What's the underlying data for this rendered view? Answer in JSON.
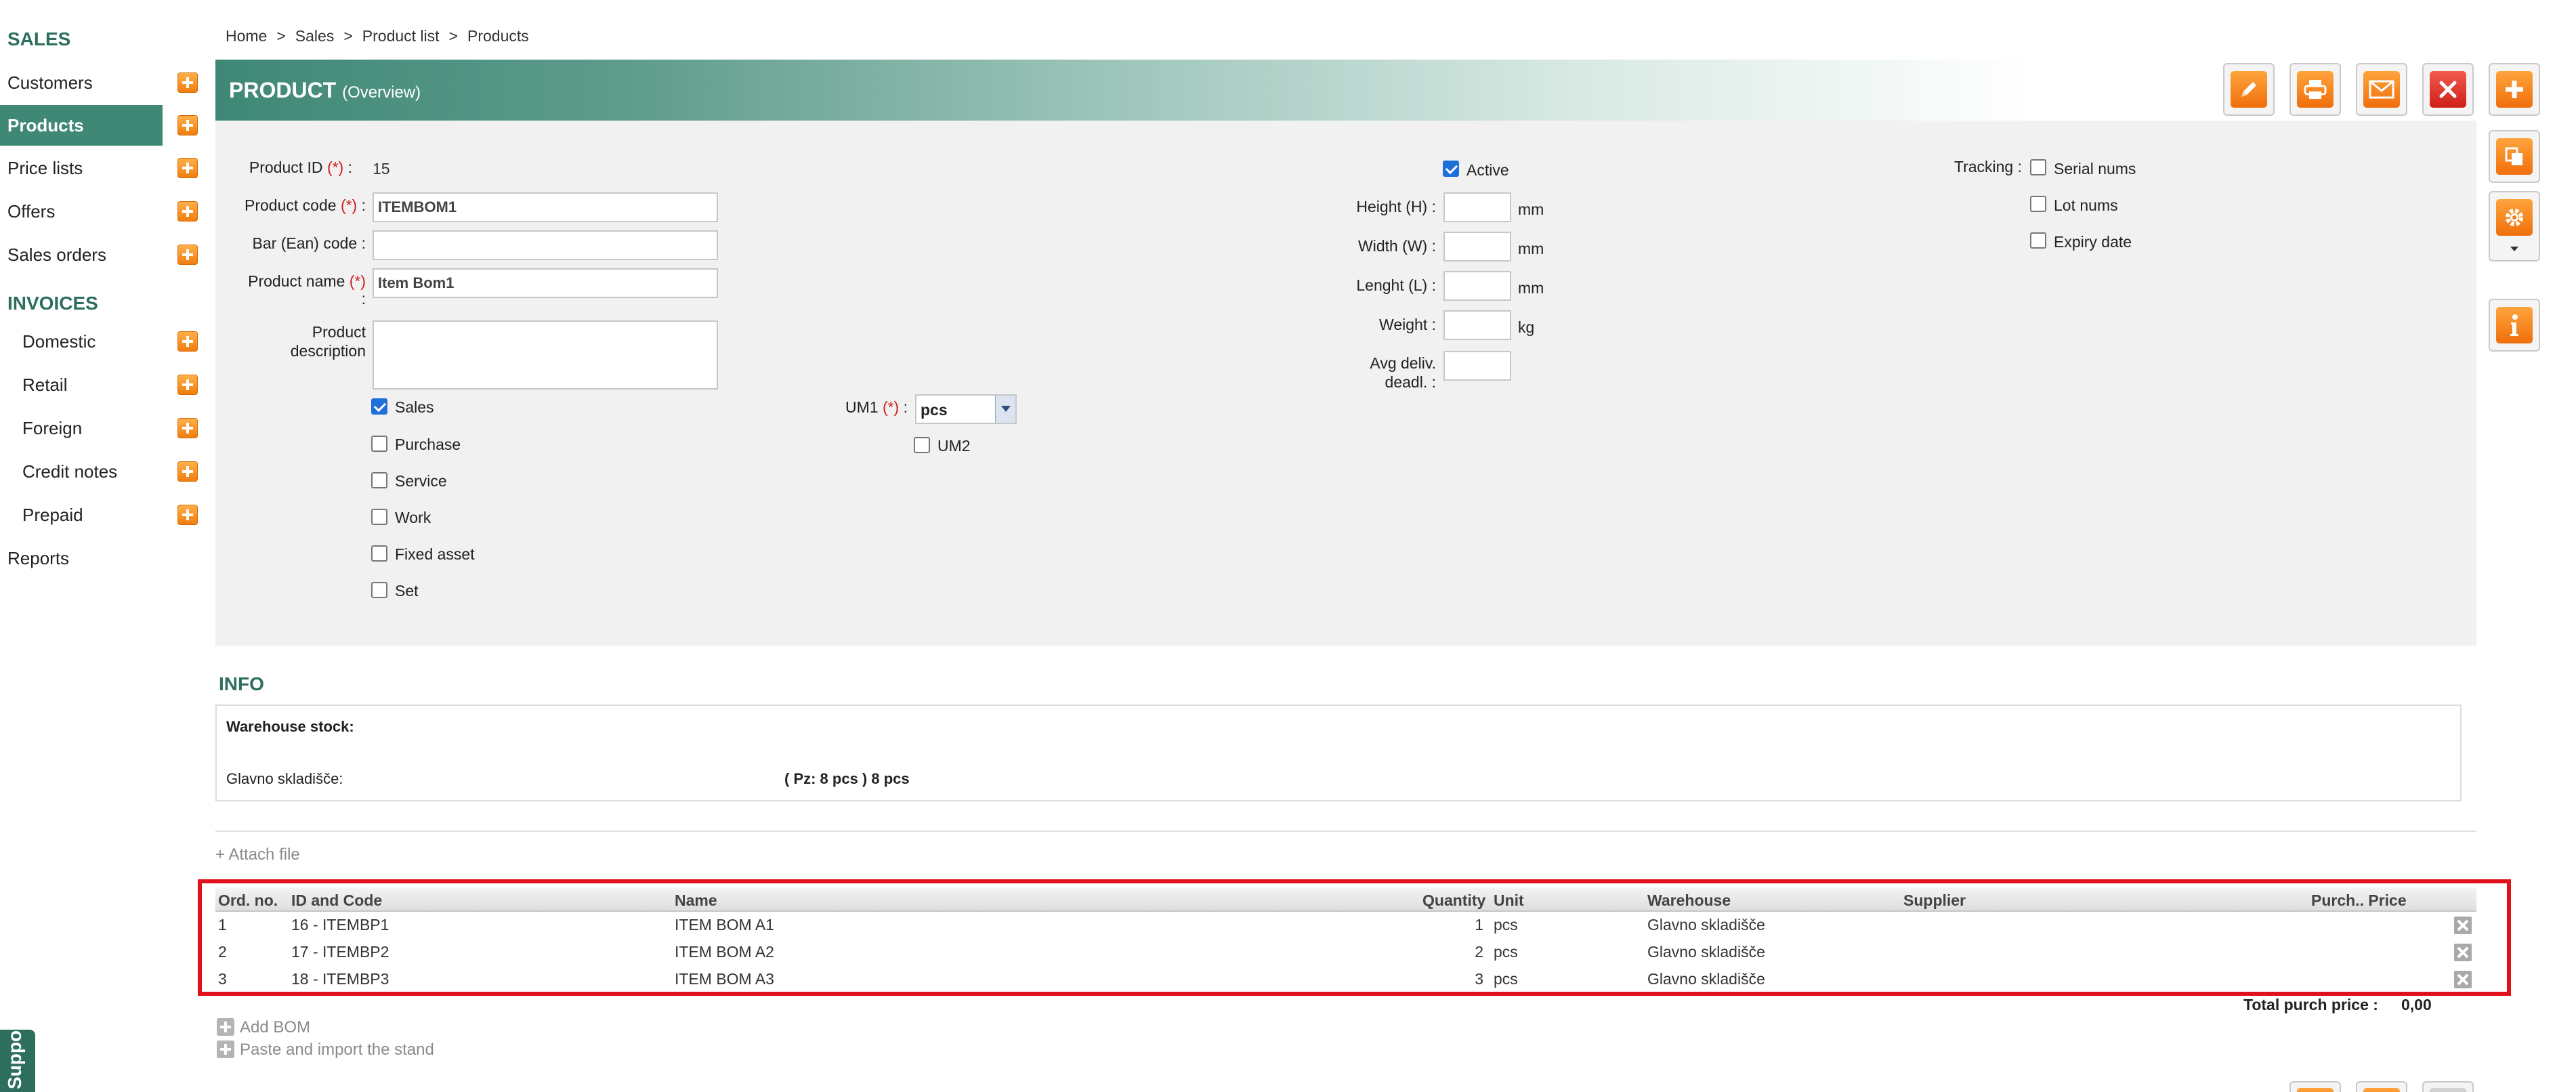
{
  "sidebar": {
    "sales_title": "SALES",
    "items": [
      {
        "label": "Customers"
      },
      {
        "label": "Products"
      },
      {
        "label": "Price lists"
      },
      {
        "label": "Offers"
      },
      {
        "label": "Sales orders"
      }
    ],
    "invoices_title": "INVOICES",
    "invoice_items": [
      {
        "label": "Domestic"
      },
      {
        "label": "Retail"
      },
      {
        "label": "Foreign"
      },
      {
        "label": "Credit notes"
      },
      {
        "label": "Prepaid"
      }
    ],
    "reports": "Reports",
    "support": "Support"
  },
  "breadcrumb": {
    "home": "Home",
    "sales": "Sales",
    "product_list": "Product list",
    "products": "Products",
    "sep": ">"
  },
  "header": {
    "title": "PRODUCT",
    "subtitle": "(Overview)"
  },
  "form": {
    "product_id_label": "Product ID",
    "product_id_value": "15",
    "product_code_label": "Product code",
    "product_code_value": "ITEMBOM1",
    "bar_code_label": "Bar (Ean) code",
    "bar_code_value": "",
    "product_name_label": "Product name",
    "product_name_value": "Item Bom1",
    "product_desc_label_1": "Product",
    "product_desc_label_2": "description",
    "required_mark": "(*)",
    "colon": ":",
    "checkboxes": {
      "sales": "Sales",
      "purchase": "Purchase",
      "service": "Service",
      "work": "Work",
      "fixed_asset": "Fixed asset",
      "set": "Set"
    },
    "um1_label": "UM1",
    "um1_value": "pcs",
    "um2_label": "UM2",
    "active_label": "Active",
    "height_label": "Height (H) :",
    "width_label": "Width (W) :",
    "length_label": "Lenght (L) :",
    "weight_label": "Weight :",
    "avg_deliv_label_1": "Avg deliv.",
    "avg_deliv_label_2": "deadl. :",
    "unit_mm": "mm",
    "unit_kg": "kg",
    "tracking_label": "Tracking :",
    "serial_nums": "Serial nums",
    "lot_nums": "Lot nums",
    "expiry_date": "Expiry date"
  },
  "info": {
    "title": "INFO",
    "warehouse_stock": "Warehouse stock:",
    "warehouse_name": "Glavno skladišče:",
    "warehouse_qty": "( Pz: 8 pcs ) 8 pcs"
  },
  "attach_file": "+ Attach file",
  "bom": {
    "headers": {
      "ord_no": "Ord. no.",
      "id_code": "ID and Code",
      "name": "Name",
      "quantity": "Quantity",
      "unit": "Unit",
      "warehouse": "Warehouse",
      "supplier": "Supplier",
      "purch_price": "Purch.. Price"
    },
    "rows": [
      {
        "ord": "1",
        "id_code": "16 - ITEMBP1",
        "name": "ITEM BOM A1",
        "qty": "1",
        "unit": "pcs",
        "warehouse": "Glavno skladišče"
      },
      {
        "ord": "2",
        "id_code": "17 - ITEMBP2",
        "name": "ITEM BOM A2",
        "qty": "2",
        "unit": "pcs",
        "warehouse": "Glavno skladišče"
      },
      {
        "ord": "3",
        "id_code": "18 - ITEMBP3",
        "name": "ITEM BOM A3",
        "qty": "3",
        "unit": "pcs",
        "warehouse": "Glavno skladišče"
      }
    ],
    "total_label": "Total purch price :",
    "total_value": "0,00",
    "add_bom": "Add BOM",
    "paste_import": "Paste and import the stand"
  },
  "colors": {
    "brand_green": "#3f8876",
    "accent_orange": "#f07d10",
    "highlight_red": "#e0111b"
  },
  "icons": {
    "edit": "pencil-icon",
    "print": "printer-icon",
    "email": "envelope-icon",
    "delete": "close-icon",
    "add": "plus-icon",
    "copy": "copy-icon",
    "settings": "gear-icon",
    "info": "info-icon"
  }
}
